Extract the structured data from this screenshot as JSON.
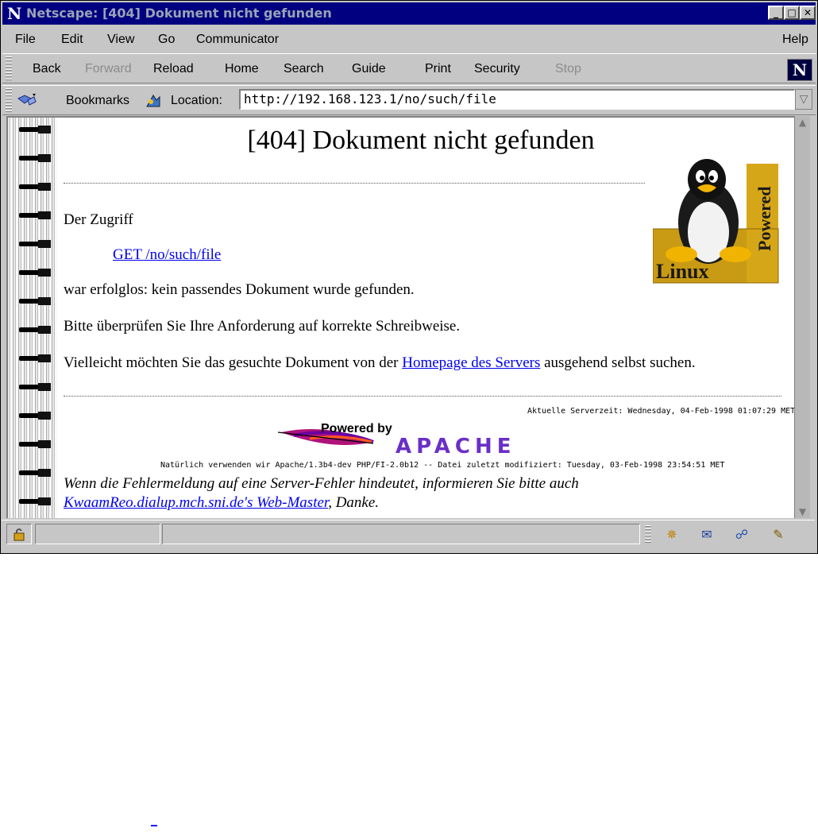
{
  "window": {
    "title": "Netscape: [404] Dokument nicht gefunden",
    "logo_letter": "N",
    "controls": {
      "minimize": "_",
      "maximize": "□",
      "close": "✕"
    }
  },
  "menubar": {
    "items": [
      "File",
      "Edit",
      "View",
      "Go",
      "Communicator"
    ],
    "help": "Help"
  },
  "nav_toolbar": {
    "back": "Back",
    "forward": "Forward",
    "reload": "Reload",
    "home": "Home",
    "search": "Search",
    "guide": "Guide",
    "print": "Print",
    "security": "Security",
    "stop": "Stop",
    "badge": "N"
  },
  "location_bar": {
    "bookmarks": "Bookmarks",
    "label": "Location:",
    "url": "http://192.168.123.1/no/such/file"
  },
  "page": {
    "heading": "[404] Dokument nicht gefunden",
    "p_access": "Der Zugriff",
    "request_link": "GET /no/such/file",
    "p_failed": "war erfolglos: kein passendes Dokument wurde gefunden.",
    "p_check": "Bitte überprüfen Sie Ihre Anforderung auf korrekte Schreibweise.",
    "p_search_before": "Vielleicht möchten Sie das gesuchte Dokument von der ",
    "homepage_link": "Homepage des Servers",
    "p_search_after": " ausgehend selbst suchen.",
    "server_time": "Aktuelle Serverzeit: Wednesday, 04-Feb-1998 01:07:29 MET",
    "apache_powered": "Powered by",
    "apache_word": "APACHE",
    "footer_small": "Natürlich verwenden wir Apache/1.3b4-dev PHP/FI-2.0b12 -- Datei zuletzt modifiziert: Tuesday, 03-Feb-1998 23:54:51 MET",
    "footer_italic_1": "Wenn die Fehlermeldung auf eine Server-Fehler hindeutet, informieren Sie bitte auch",
    "webmaster_link": "KwaamReo.dialup.mch.sni.de's Web-Master",
    "footer_italic_2_after": ", Danke.",
    "linux_badge_word_1": "Powered",
    "linux_badge_word_2": "Linux"
  },
  "colors": {
    "titlebar": "#000080",
    "link": "#0000ee",
    "chrome": "#c6c6c6"
  },
  "icons": [
    "netscape-logo-icon",
    "bookmarks-icon",
    "location-icon",
    "lock-icon",
    "navigator-icon",
    "mail-icon",
    "discussion-icon",
    "composer-icon"
  ]
}
